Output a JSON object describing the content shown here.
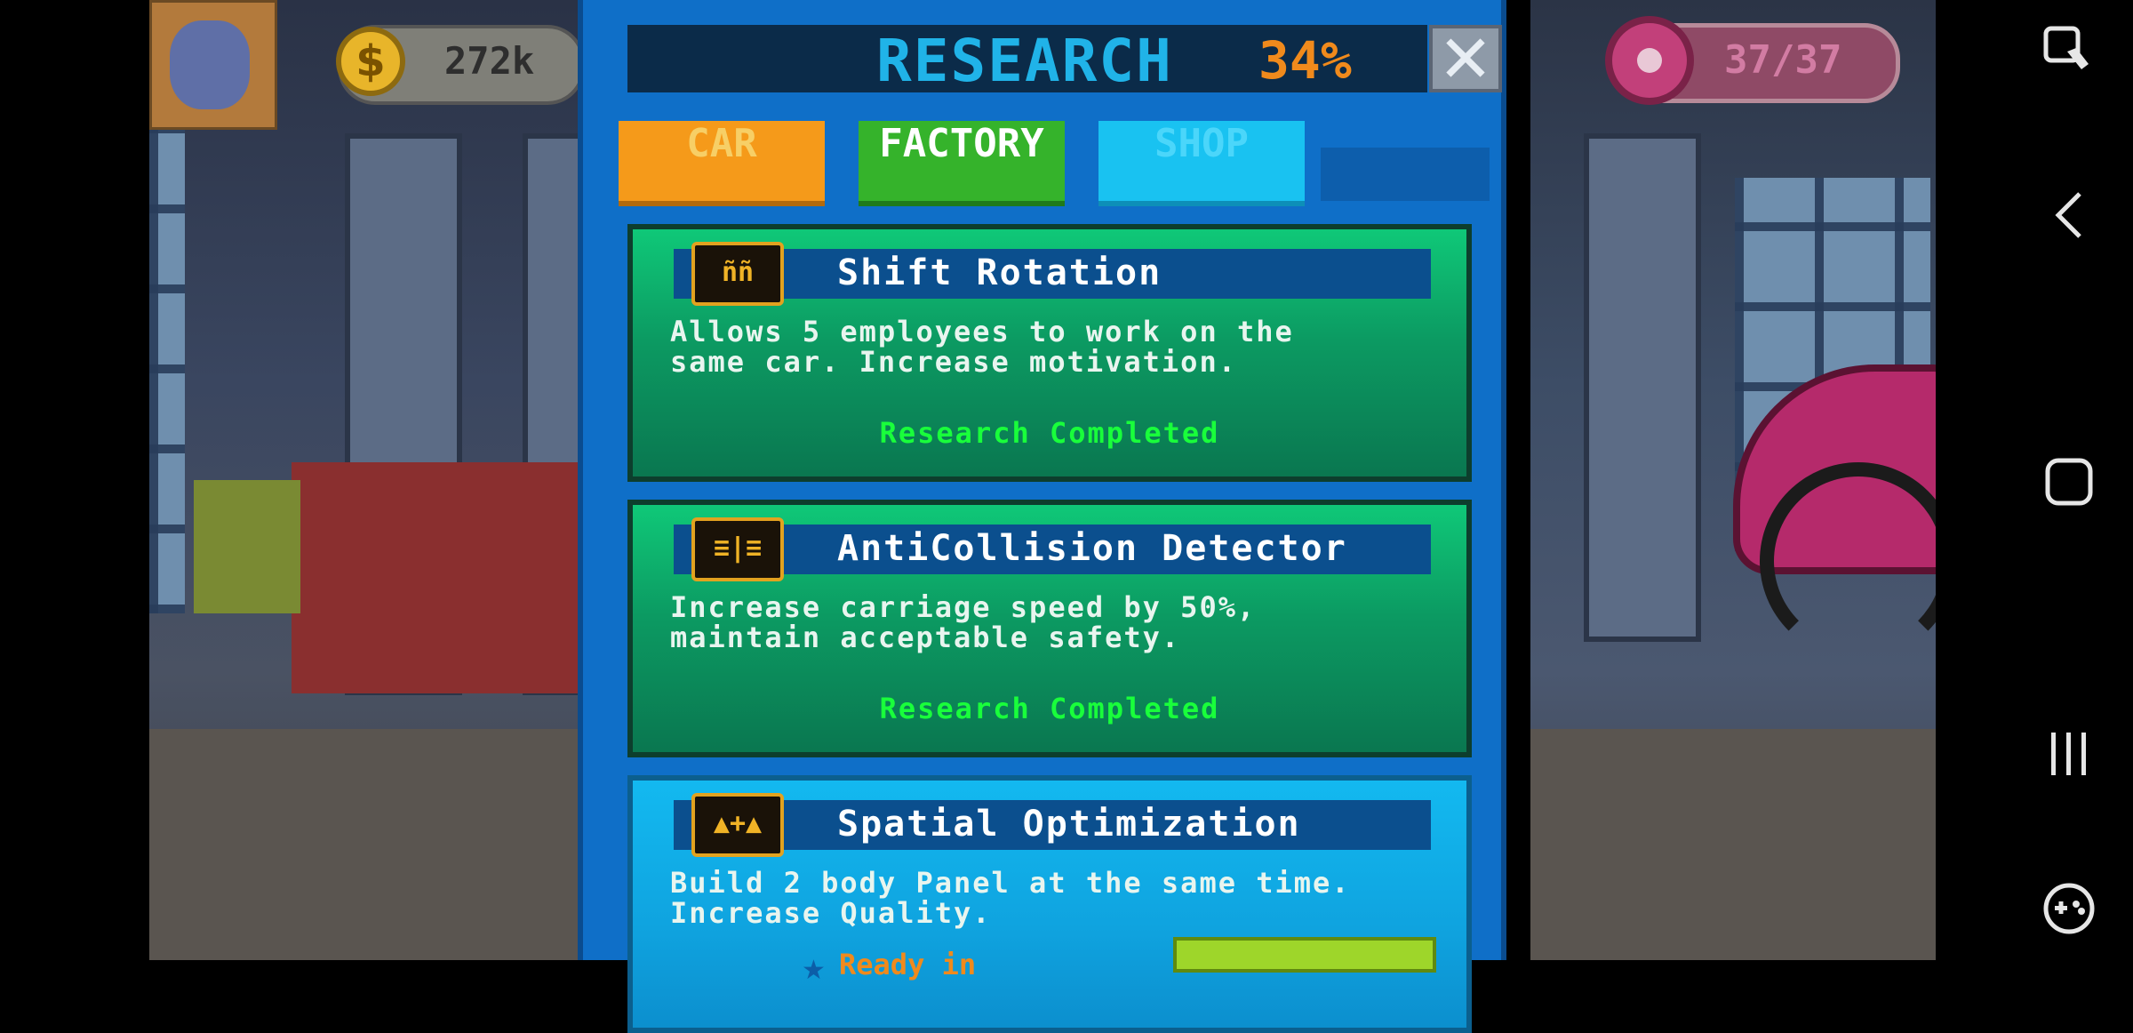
{
  "hud": {
    "coins": "272k",
    "coin_symbol": "$",
    "donuts": "37/37"
  },
  "research": {
    "title": "RESEARCH",
    "percent": "34%",
    "close_symbol": "✕",
    "tabs": [
      {
        "label": "CAR",
        "active": false
      },
      {
        "label": "FACTORY",
        "active": true
      },
      {
        "label": "SHOP",
        "active": false
      }
    ],
    "items": [
      {
        "title": "Shift Rotation",
        "icon": "workers-icon",
        "desc": "Allows 5 employees to work on the\nsame car. Increase motivation.",
        "status": "Research Completed"
      },
      {
        "title": "AntiCollision Detector",
        "icon": "carriage-sensor-icon",
        "desc": "Increase carriage speed by 50%,\nmaintain acceptable safety.",
        "status": "Research Completed"
      },
      {
        "title": "Spatial Optimization",
        "icon": "car-panels-icon",
        "desc": "Build 2 body Panel at the same time.\nIncrease Quality.",
        "status": "Ready in"
      }
    ]
  },
  "colors": {
    "panel": "#0f6fc8",
    "title": "#20b3e8",
    "percent": "#f08a1c",
    "completed": "#19ff3b",
    "tab_car": "#f59a1a",
    "tab_factory": "#35b32b",
    "tab_shop": "#19c2f1"
  },
  "system_nav": [
    "screenshot-edit-icon",
    "back-icon",
    "home-icon",
    "recents-icon",
    "game-tools-icon"
  ]
}
